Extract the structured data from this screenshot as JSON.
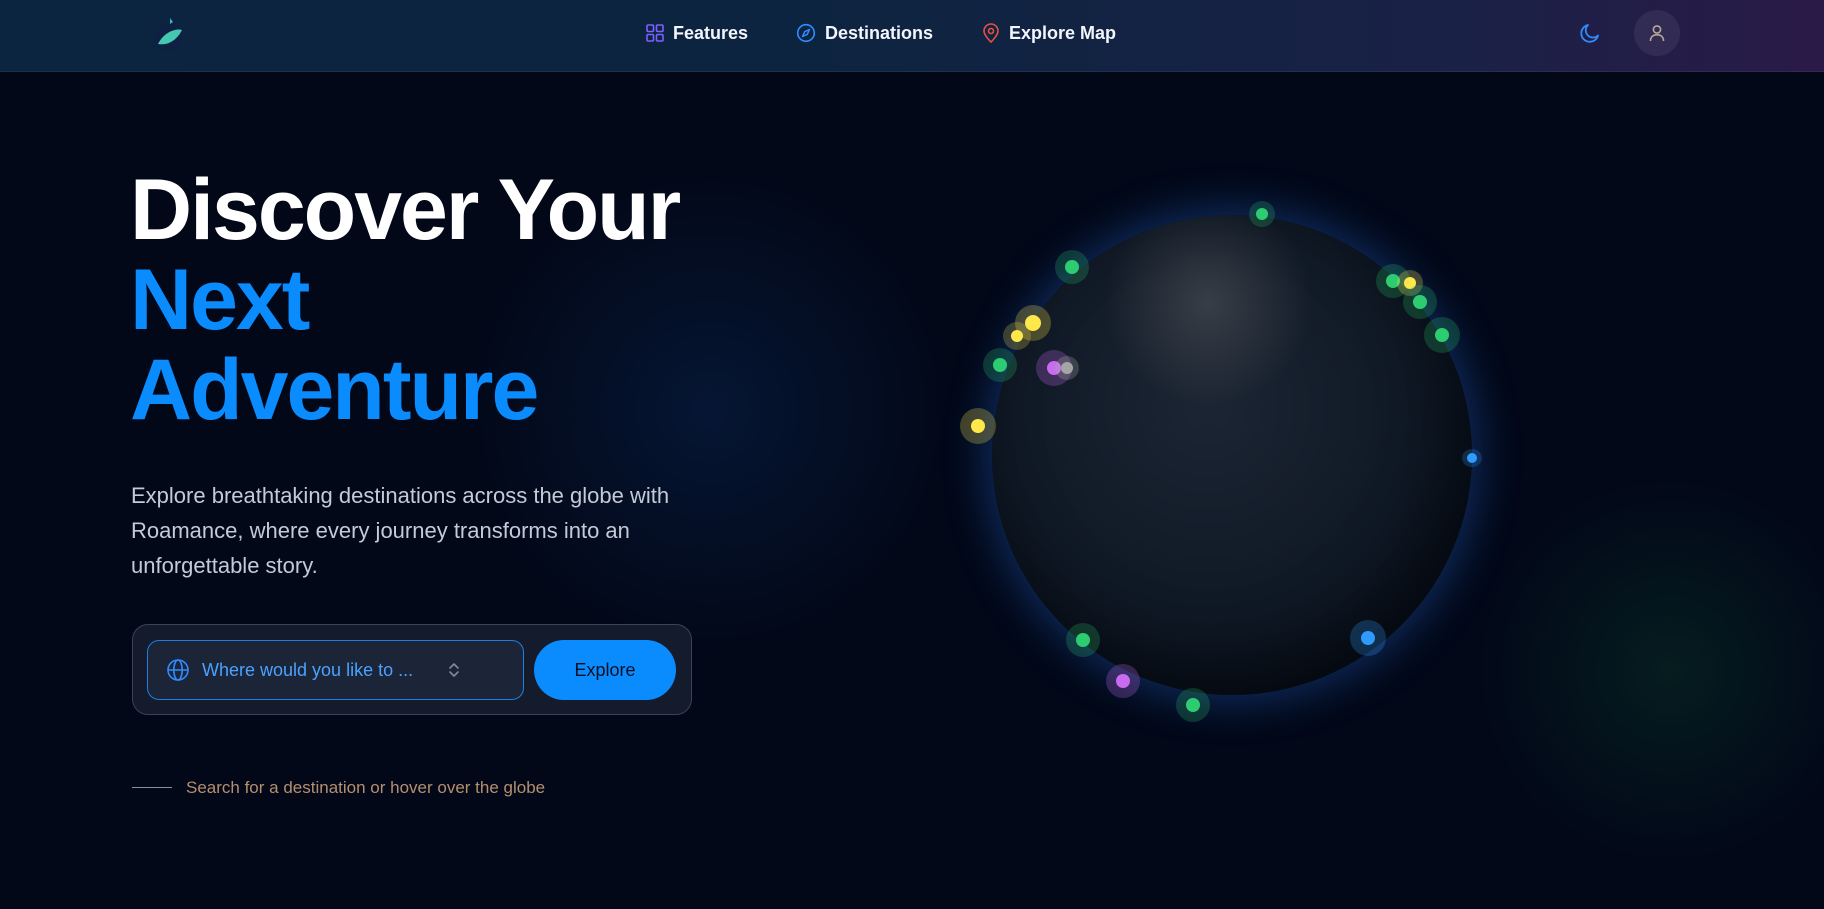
{
  "nav": {
    "items": [
      {
        "label": "Features",
        "icon": "grid-icon",
        "color": "#7b61ff"
      },
      {
        "label": "Destinations",
        "icon": "compass-icon",
        "color": "#2f8cff"
      },
      {
        "label": "Explore Map",
        "icon": "map-pin-icon",
        "color": "#e5533d"
      }
    ],
    "theme_icon": "moon-icon",
    "user_icon": "user-icon"
  },
  "hero": {
    "title_line1": "Discover Your",
    "title_line2": "Next",
    "title_line3": "Adventure",
    "subtitle": "Explore breathtaking destinations across the globe with Roamance, where every journey transforms into an unforgettable story."
  },
  "search": {
    "placeholder": "Where would you like to ...",
    "button_label": "Explore",
    "hint": "Search for a destination or hover over the globe"
  },
  "colors": {
    "accent": "#0a8cff",
    "background": "#020818",
    "marker_green": "#2ecc71",
    "marker_yellow": "#ffe84a",
    "marker_purple": "#c86bf0",
    "marker_blue": "#2f9bff"
  }
}
